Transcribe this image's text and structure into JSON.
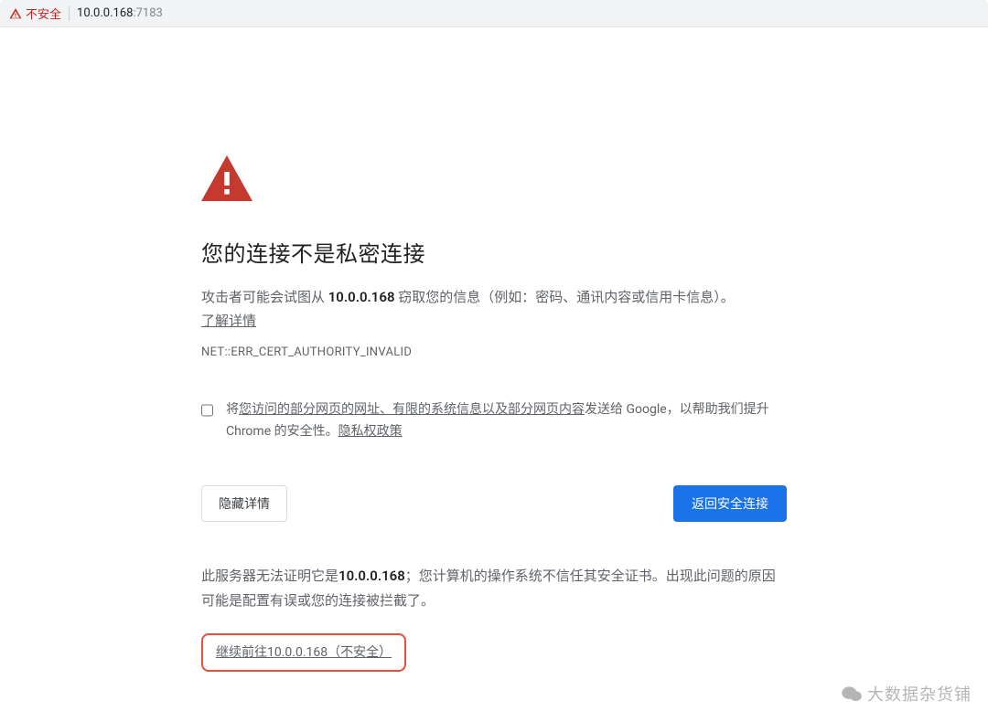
{
  "urlbar": {
    "security_label": "不安全",
    "host": "10.0.0.168",
    "port": ":7183"
  },
  "page": {
    "heading": "您的连接不是私密连接",
    "warn_prefix": "攻击者可能会试图从 ",
    "warn_host": "10.0.0.168",
    "warn_suffix": " 窃取您的信息（例如：密码、通讯内容或信用卡信息）。",
    "learn_more": "了解详情",
    "error_code": "NET::ERR_CERT_AUTHORITY_INVALID",
    "optin_prefix": "将",
    "optin_link": "您访问的部分网页的网址、有限的系统信息以及部分网页内容",
    "optin_mid": "发送给 Google，以帮助我们提升 Chrome 的安全性。",
    "privacy_policy": "隐私权政策",
    "hide_details_btn": "隐藏详情",
    "back_safety_btn": "返回安全连接",
    "detail_prefix": "此服务器无法证明它是",
    "detail_host": "10.0.0.168",
    "detail_suffix": "；您计算机的操作系统不信任其安全证书。出现此问题的原因可能是配置有误或您的连接被拦截了。",
    "proceed_link": "继续前往10.0.0.168（不安全）"
  },
  "watermark": {
    "text": "大数据杂货铺"
  },
  "colors": {
    "danger": "#c5221f",
    "primary": "#1a73e8",
    "highlight_border": "#e8503a"
  }
}
